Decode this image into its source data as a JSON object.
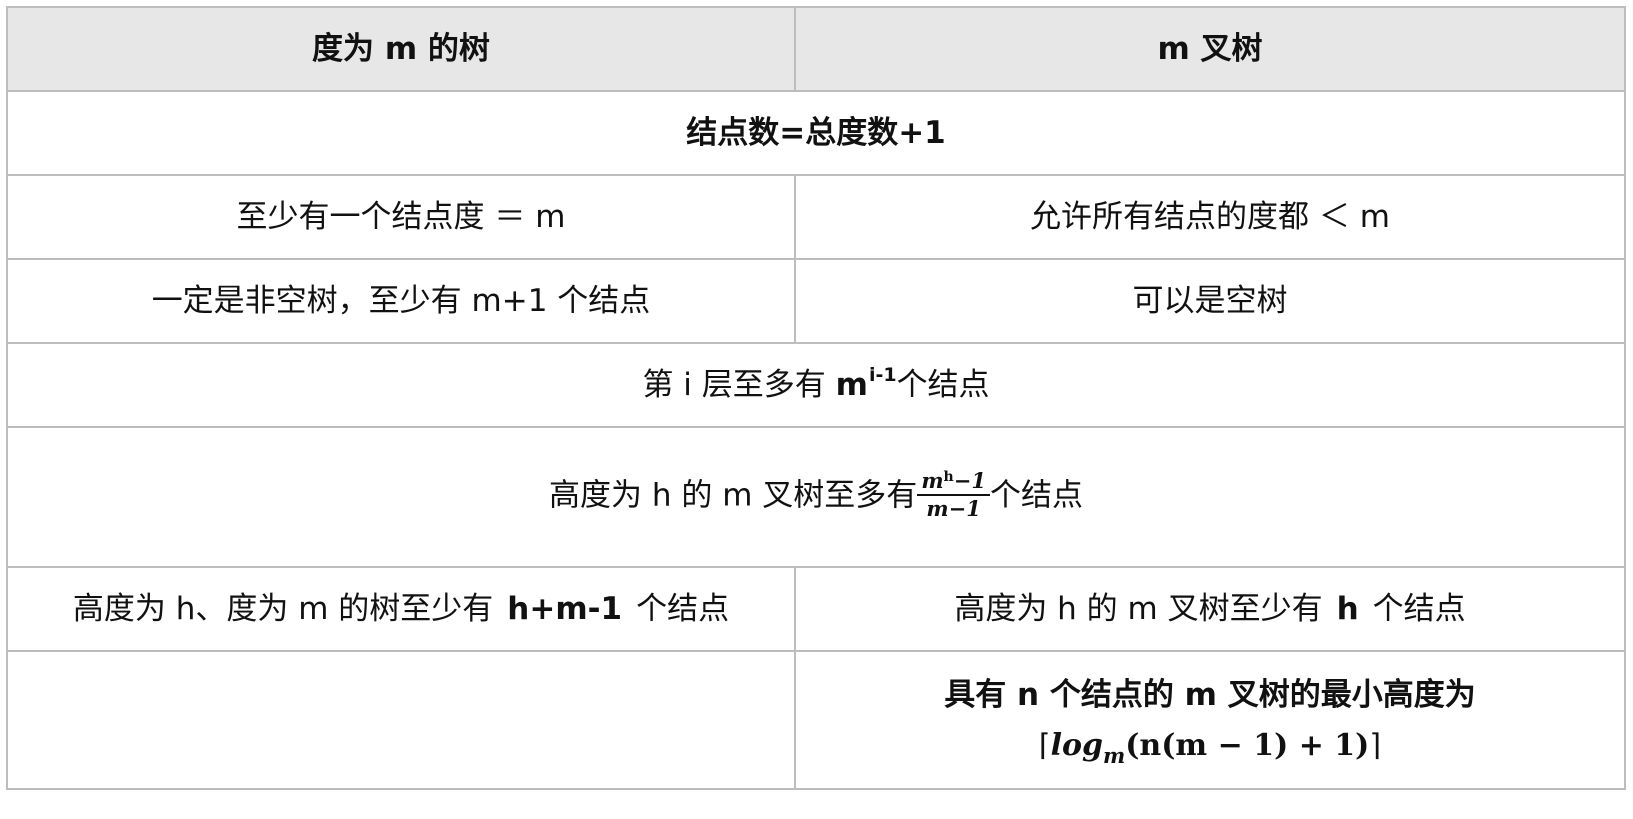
{
  "header": {
    "col1": "度为 m 的树",
    "col2": "m 叉树"
  },
  "rows": {
    "node_count": "结点数=总度数+1",
    "degree_left": "至少有一个结点度 ＝ m",
    "degree_right": "允许所有结点的度都 ＜ m",
    "empty_left": "一定是非空树，至少有 m+1 个结点",
    "empty_right": "可以是空树",
    "level": {
      "prefix": "第 i 层至多有",
      "base": "m",
      "exponent": "i-1",
      "suffix": "个结点"
    },
    "height_max": {
      "prefix": "高度为 h 的 m 叉树至多有",
      "num_base": "m",
      "num_exp": "h",
      "num_tail": "−1",
      "den": "m−1",
      "suffix": "个结点"
    },
    "height_min_left": {
      "prefix": "高度为 h、度为 m 的树至少有",
      "value": "h+m-1",
      "suffix": "个结点"
    },
    "height_min_right": {
      "prefix": "高度为 h 的 m 叉树至少有",
      "value": "h",
      "suffix": "个结点"
    },
    "min_height": {
      "text": "具有 n 个结点的 m 叉树的最小高度为",
      "ceil_open": "⌈",
      "log": "log",
      "log_sub": "m",
      "arg": "(n(m − 1) + 1)",
      "ceil_close": "⌉"
    }
  }
}
